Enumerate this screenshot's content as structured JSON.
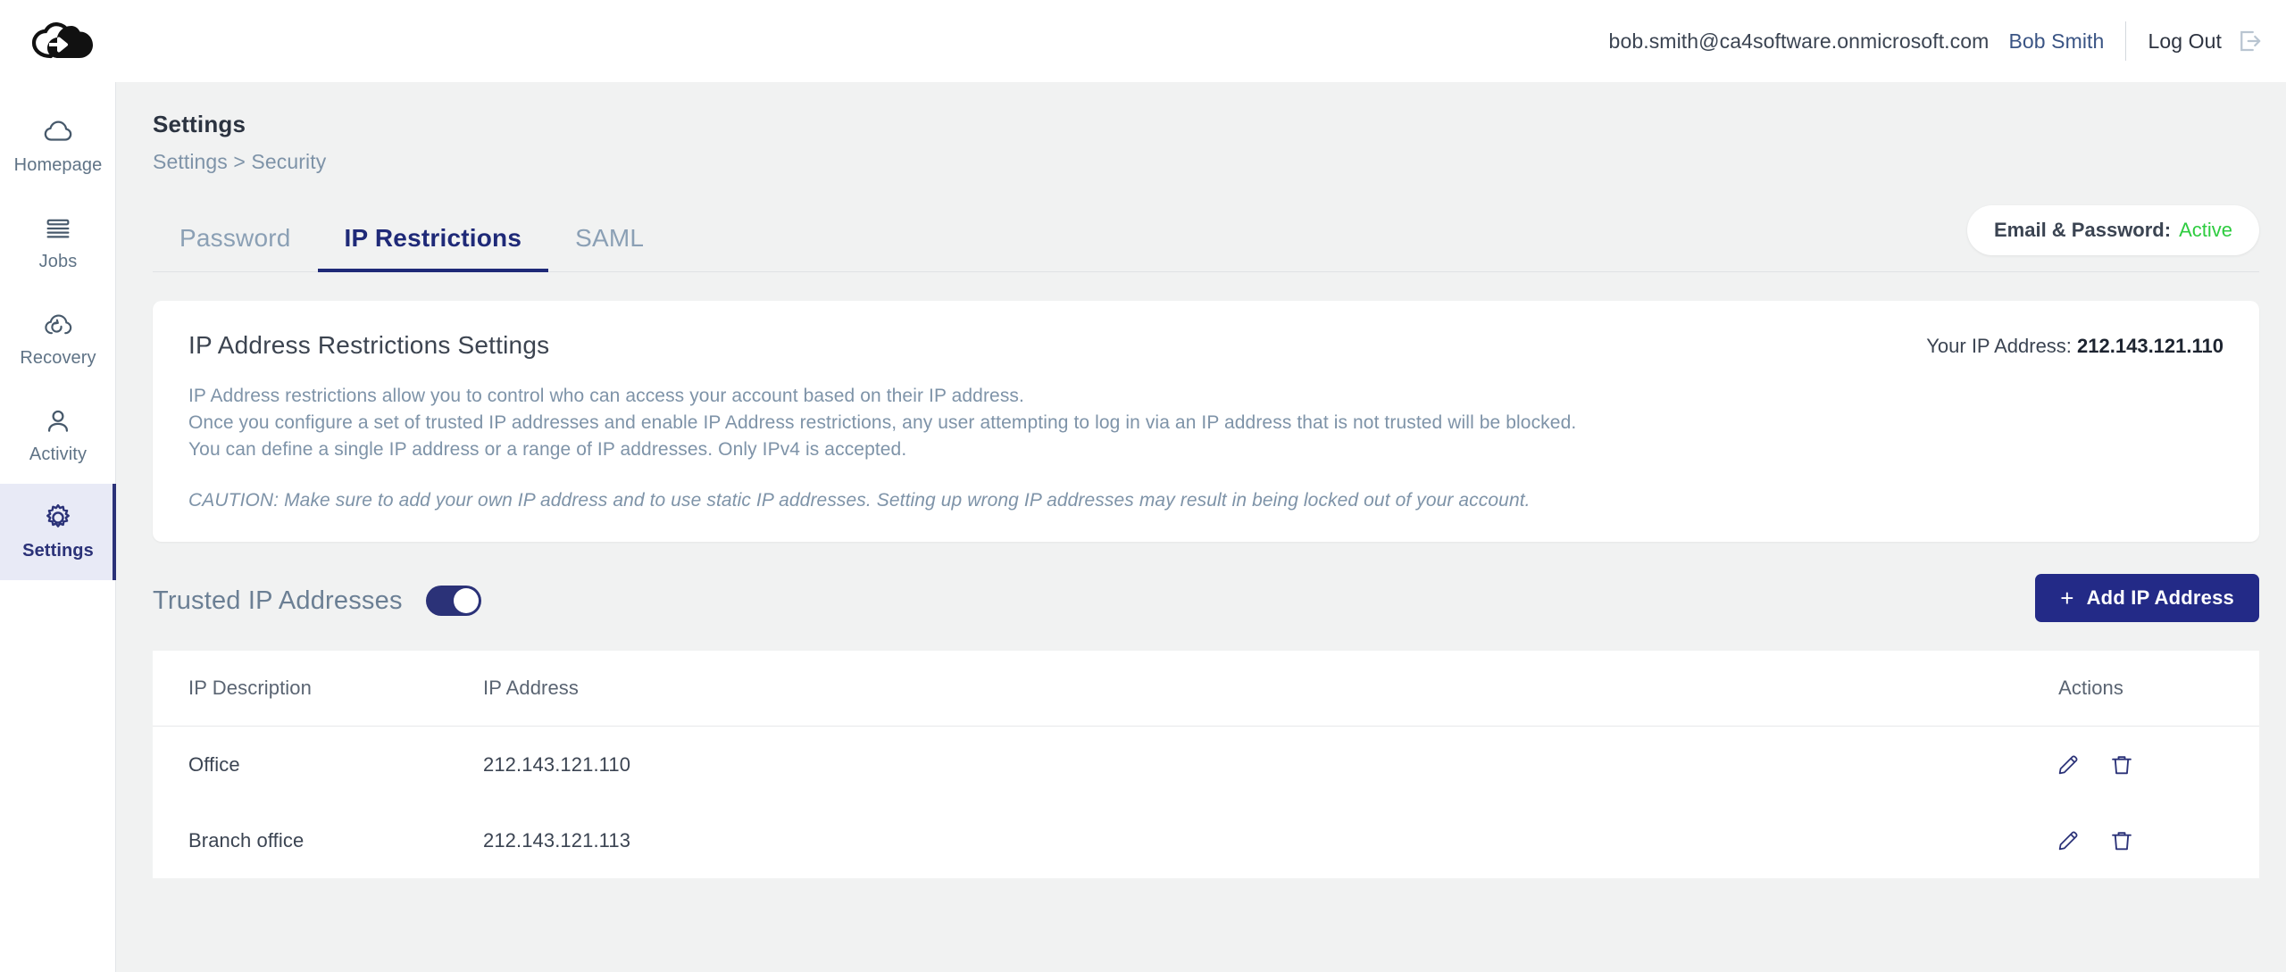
{
  "header": {
    "logo_icon": "cloud-arrow-logo",
    "email": "bob.smith@ca4software.onmicrosoft.com",
    "user_name": "Bob Smith",
    "logout_label": "Log Out",
    "logout_icon": "logout-arrow-icon"
  },
  "sidebar": {
    "items": [
      {
        "label": "Homepage",
        "icon": "cloud-icon",
        "active": false
      },
      {
        "label": "Jobs",
        "icon": "stacked-lines-icon",
        "active": false
      },
      {
        "label": "Recovery",
        "icon": "cloud-refresh-icon",
        "active": false
      },
      {
        "label": "Activity",
        "icon": "user-icon",
        "active": false
      },
      {
        "label": "Settings",
        "icon": "gear-icon",
        "active": true
      }
    ]
  },
  "page": {
    "title": "Settings",
    "breadcrumb": "Settings > Security",
    "status_pill": {
      "label": "Email & Password:",
      "value": "Active",
      "value_color": "#2ecc40"
    }
  },
  "tabs": [
    {
      "label": "Password",
      "active": false
    },
    {
      "label": "IP Restrictions",
      "active": true
    },
    {
      "label": "SAML",
      "active": false
    }
  ],
  "info_card": {
    "title": "IP Address Restrictions Settings",
    "your_ip_label": "Your IP Address:",
    "your_ip_value": "212.143.121.110",
    "paragraphs": [
      "IP Address restrictions allow you to control who can access your account based on their IP address.",
      "Once you configure a set of trusted IP addresses and enable IP Address restrictions, any user attempting to log in via an IP address that is not trusted will be blocked.",
      "You can define a single IP address or a range of IP addresses. Only IPv4 is accepted."
    ],
    "caution": "CAUTION: Make sure to add your own IP address and to use static IP addresses. Setting up wrong IP addresses may result in being locked out of your account."
  },
  "trusted": {
    "title": "Trusted IP Addresses",
    "toggle_on": true,
    "add_button_label": "Add IP Address",
    "add_button_icon": "plus-icon",
    "add_button_color": "#232a87"
  },
  "table": {
    "columns": [
      "IP Description",
      "IP Address",
      "Actions"
    ],
    "rows": [
      {
        "description": "Office",
        "ip": "212.143.121.110",
        "edit_icon": "pencil-icon",
        "delete_icon": "trash-icon"
      },
      {
        "description": "Branch office",
        "ip": "212.143.121.113",
        "edit_icon": "pencil-icon",
        "delete_icon": "trash-icon"
      }
    ]
  },
  "colors": {
    "background": "#f1f2f2",
    "card": "#ffffff",
    "navy": "#2b3278",
    "muted_text": "#7e93a8",
    "active_green": "#2ecc40"
  }
}
